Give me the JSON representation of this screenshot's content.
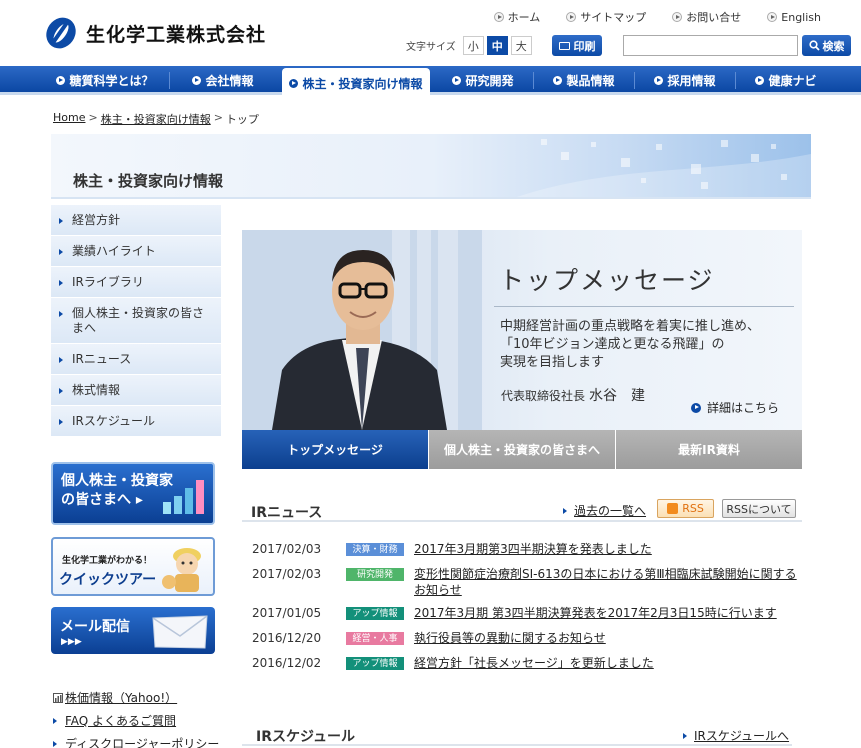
{
  "header": {
    "company_name": "生化学工業株式会社",
    "util_links": [
      "ホーム",
      "サイトマップ",
      "お問い合せ",
      "English"
    ],
    "font_size_label": "文字サイズ",
    "font_sizes": [
      "小",
      "中",
      "大"
    ],
    "print_label": "印刷",
    "search_placeholder": "",
    "search_label": "検索"
  },
  "nav": {
    "items": [
      "糖質科学とは？",
      "会社情報",
      "株主・投資家向け情報",
      "研究開発",
      "製品情報",
      "採用情報",
      "健康ナビ"
    ]
  },
  "breadcrumb": [
    "Home",
    "株主・投資家向け情報",
    "トップ"
  ],
  "banner": {
    "title": "株主・投資家向け情報"
  },
  "side_nav": [
    "経営方針",
    "業績ハイライト",
    "IRライブラリ",
    "個人株主・投資家の皆さまへ",
    "IRニュース",
    "株式情報",
    "IRスケジュール"
  ],
  "side_banners": {
    "individual": [
      "個人株主・投資家",
      "の皆さまへ"
    ],
    "tour_sub": "生化学工業がわかる！",
    "tour_title": "クイックツアー",
    "mail": "メール配信",
    "mail_arrows": "▶▶▶"
  },
  "side_links": [
    "株価情報（Yahoo!）",
    "FAQ よくあるご質問",
    "ディスクロージャーポリシー"
  ],
  "hero": {
    "title": "トップメッセージ",
    "body": [
      "中期経営計画の重点戦略を着実に推し進め、",
      "「10年ビジョン達成と更なる飛躍」の",
      "実現を目指します"
    ],
    "sig_title": "代表取締役社長",
    "sig_name": "水谷　建",
    "more": "詳細はこちら"
  },
  "tabs": [
    "トップメッセージ",
    "個人株主・投資家の皆さまへ",
    "最新IR資料"
  ],
  "news": {
    "title": "IRニュース",
    "past_link": "過去の一覧へ",
    "rss": "RSS",
    "rss_about": "RSSについて",
    "items": [
      {
        "date": "2017/02/03",
        "tag": "決算・財務",
        "tag_color": "#5b8fd8",
        "text": "2017年3月期第3四半期決算を発表しました"
      },
      {
        "date": "2017/02/03",
        "tag": "研究開発",
        "tag_color": "#4fb56a",
        "text": "変形性関節症治療剤SI-613の日本における第Ⅲ相臨床試験開始に関するお知らせ"
      },
      {
        "date": "2017/01/05",
        "tag": "アップ情報",
        "tag_color": "#13907a",
        "text": "2017年3月期 第3四半期決算発表を2017年2月3日15時に行います"
      },
      {
        "date": "2016/12/20",
        "tag": "経営・人事",
        "tag_color": "#e87aa0",
        "text": "執行役員等の異動に関するお知らせ"
      },
      {
        "date": "2016/12/02",
        "tag": "アップ情報",
        "tag_color": "#13907a",
        "text": "経営方針「社長メッセージ」を更新しました"
      }
    ]
  },
  "schedule": {
    "title": "IRスケジュール",
    "link": "IRスケジュールへ"
  }
}
